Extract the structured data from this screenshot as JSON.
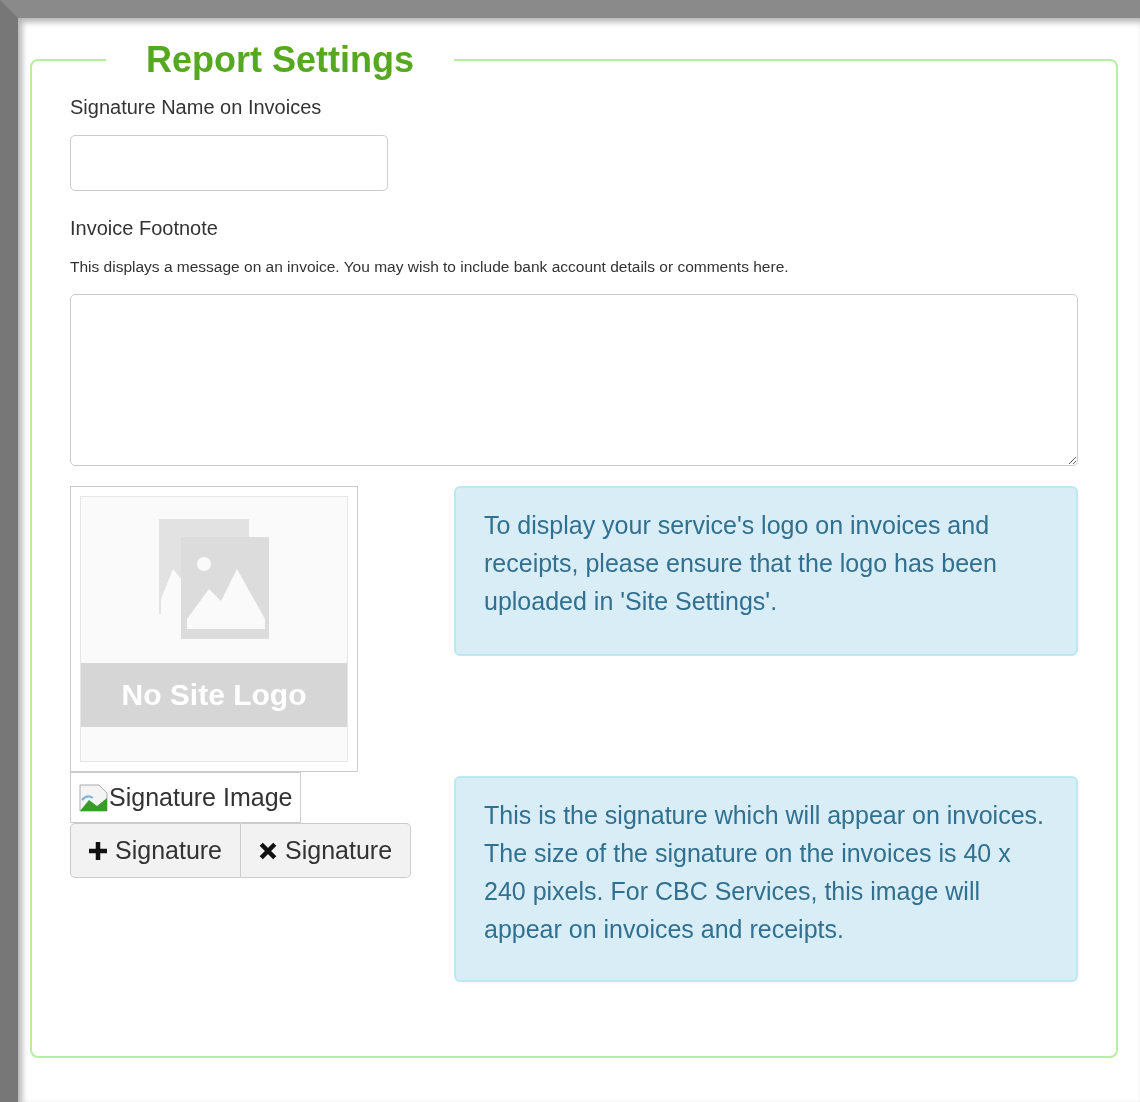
{
  "panel": {
    "title": "Report Settings"
  },
  "signature_name": {
    "label": "Signature Name on Invoices"
  },
  "invoice_footnote": {
    "label": "Invoice Footnote",
    "help": "This displays a message on an invoice. You may wish to include bank account details or comments here."
  },
  "site_logo": {
    "caption": "No Site Logo"
  },
  "logo_info": "To display your service's logo on invoices and receipts, please ensure that the logo has been uploaded in 'Site Settings'.",
  "signature_image": {
    "alt": "Signature Image"
  },
  "buttons": [
    {
      "kind": "add",
      "label": "Signature"
    },
    {
      "kind": "remove",
      "label": "Signature"
    }
  ],
  "signature_info": "This is the signature which will appear on invoices. The size of the signature on the invoices is 40 x 240 pixels. For CBC Services, this image will appear on invoices and receipts."
}
